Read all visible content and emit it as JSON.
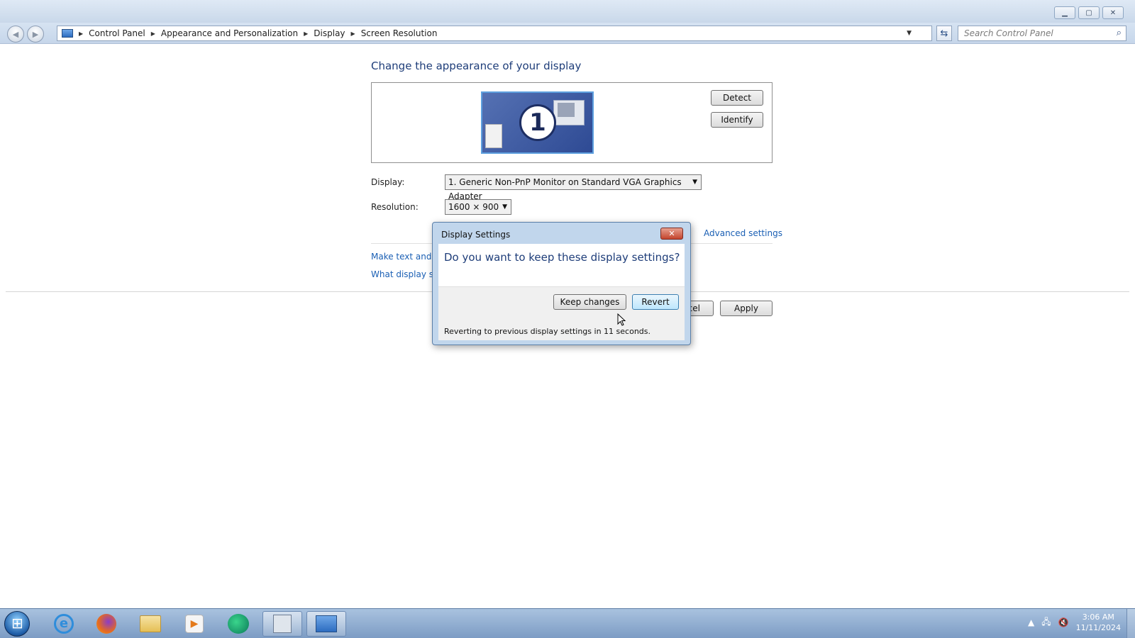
{
  "window": {
    "minimize_icon": "minimize-icon",
    "maximize_icon": "maximize-icon",
    "close_icon": "close-icon"
  },
  "address_bar": {
    "breadcrumbs": [
      "Control Panel",
      "Appearance and Personalization",
      "Display",
      "Screen Resolution"
    ],
    "search_placeholder": "Search Control Panel"
  },
  "main": {
    "heading": "Change the appearance of your display",
    "monitor_number": "1",
    "detect_label": "Detect",
    "identify_label": "Identify",
    "display_label": "Display:",
    "display_value": "1. Generic Non-PnP Monitor on Standard VGA Graphics Adapter",
    "resolution_label": "Resolution:",
    "resolution_value": "1600 × 900",
    "advanced_link": "Advanced settings",
    "link1_partial": "Make text and ot",
    "link2_partial": "What display set",
    "cancel_partial": "cel",
    "apply_label": "Apply"
  },
  "dialog": {
    "title": "Display Settings",
    "question": "Do you want to keep these display settings?",
    "keep_label": "Keep changes",
    "revert_label": "Revert",
    "status": "Reverting to previous display settings in 11 seconds."
  },
  "taskbar": {
    "time": "3:06 AM",
    "date": "11/11/2024"
  },
  "colors": {
    "heading": "#1e3d79",
    "link": "#1a5fb4",
    "taskbar": "#8fabd0"
  }
}
